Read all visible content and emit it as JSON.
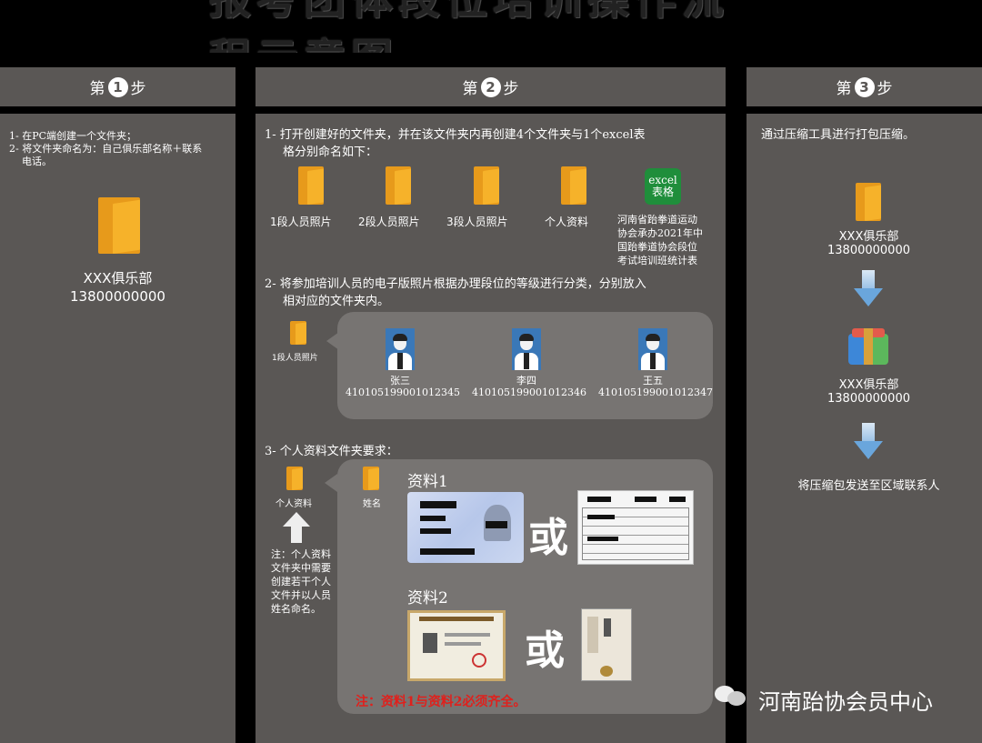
{
  "title": "报考团体段位培训操作流程示意图",
  "steps": {
    "prefix": "第",
    "suffix": "步",
    "n1": "1",
    "n2": "2",
    "n3": "3"
  },
  "step1": {
    "line1": "1- 在PC端创建一个文件夹；",
    "line2": "2- 将文件夹命名为：自己俱乐部名称＋联系",
    "line2b": "电话。",
    "folder_name": "XXX俱乐部",
    "folder_phone": "13800000000"
  },
  "step2": {
    "intro1": "1- 打开创建好的文件夹，并在该文件夹内再创建4个文件夹与1个excel表",
    "intro1b": "格分别命名如下：",
    "folders": [
      "1段人员照片",
      "2段人员照片",
      "3段人员照片",
      "个人资料"
    ],
    "excel_top": "excel",
    "excel_bottom": "表格",
    "excel_caption": [
      "河南省跆拳道运动",
      "协会承办2021年中",
      "国跆拳道协会段位",
      "考试培训班统计表"
    ],
    "intro2": "2- 将参加培训人员的电子版照片根据办理段位的等级进行分类，分别放入",
    "intro2b": "相对应的文件夹内。",
    "small_folder1": "1段人员照片",
    "people": [
      {
        "name": "张三",
        "id": "410105199001012345"
      },
      {
        "name": "李四",
        "id": "410105199001012346"
      },
      {
        "name": "王五",
        "id": "410105199001012347"
      }
    ],
    "intro3": "3- 个人资料文件夹要求：",
    "small_folder2": "个人资料",
    "small_folder3": "姓名",
    "note_lines": [
      "注：个人资料",
      "文件夹中需要",
      "创建若干个人",
      "文件并以人员",
      "姓名命名。"
    ],
    "doc1_label": "资料1",
    "doc2_label": "资料2",
    "or_text": "或",
    "red_note": "注：资料1与资料2必须齐全。"
  },
  "step3": {
    "intro": "通过压缩工具进行打包压缩。",
    "folder_name": "XXX俱乐部",
    "folder_phone": "13800000000",
    "zip_name": "XXX俱乐部",
    "zip_phone": "13800000000",
    "send_text": "将压缩包发送至区域联系人"
  },
  "watermark": "河南跆协会员中心",
  "colors": {
    "panel": "#5a5755",
    "folder": "#f6b22a",
    "red_note": "#e0201c",
    "excel": "#1f8e3b"
  }
}
